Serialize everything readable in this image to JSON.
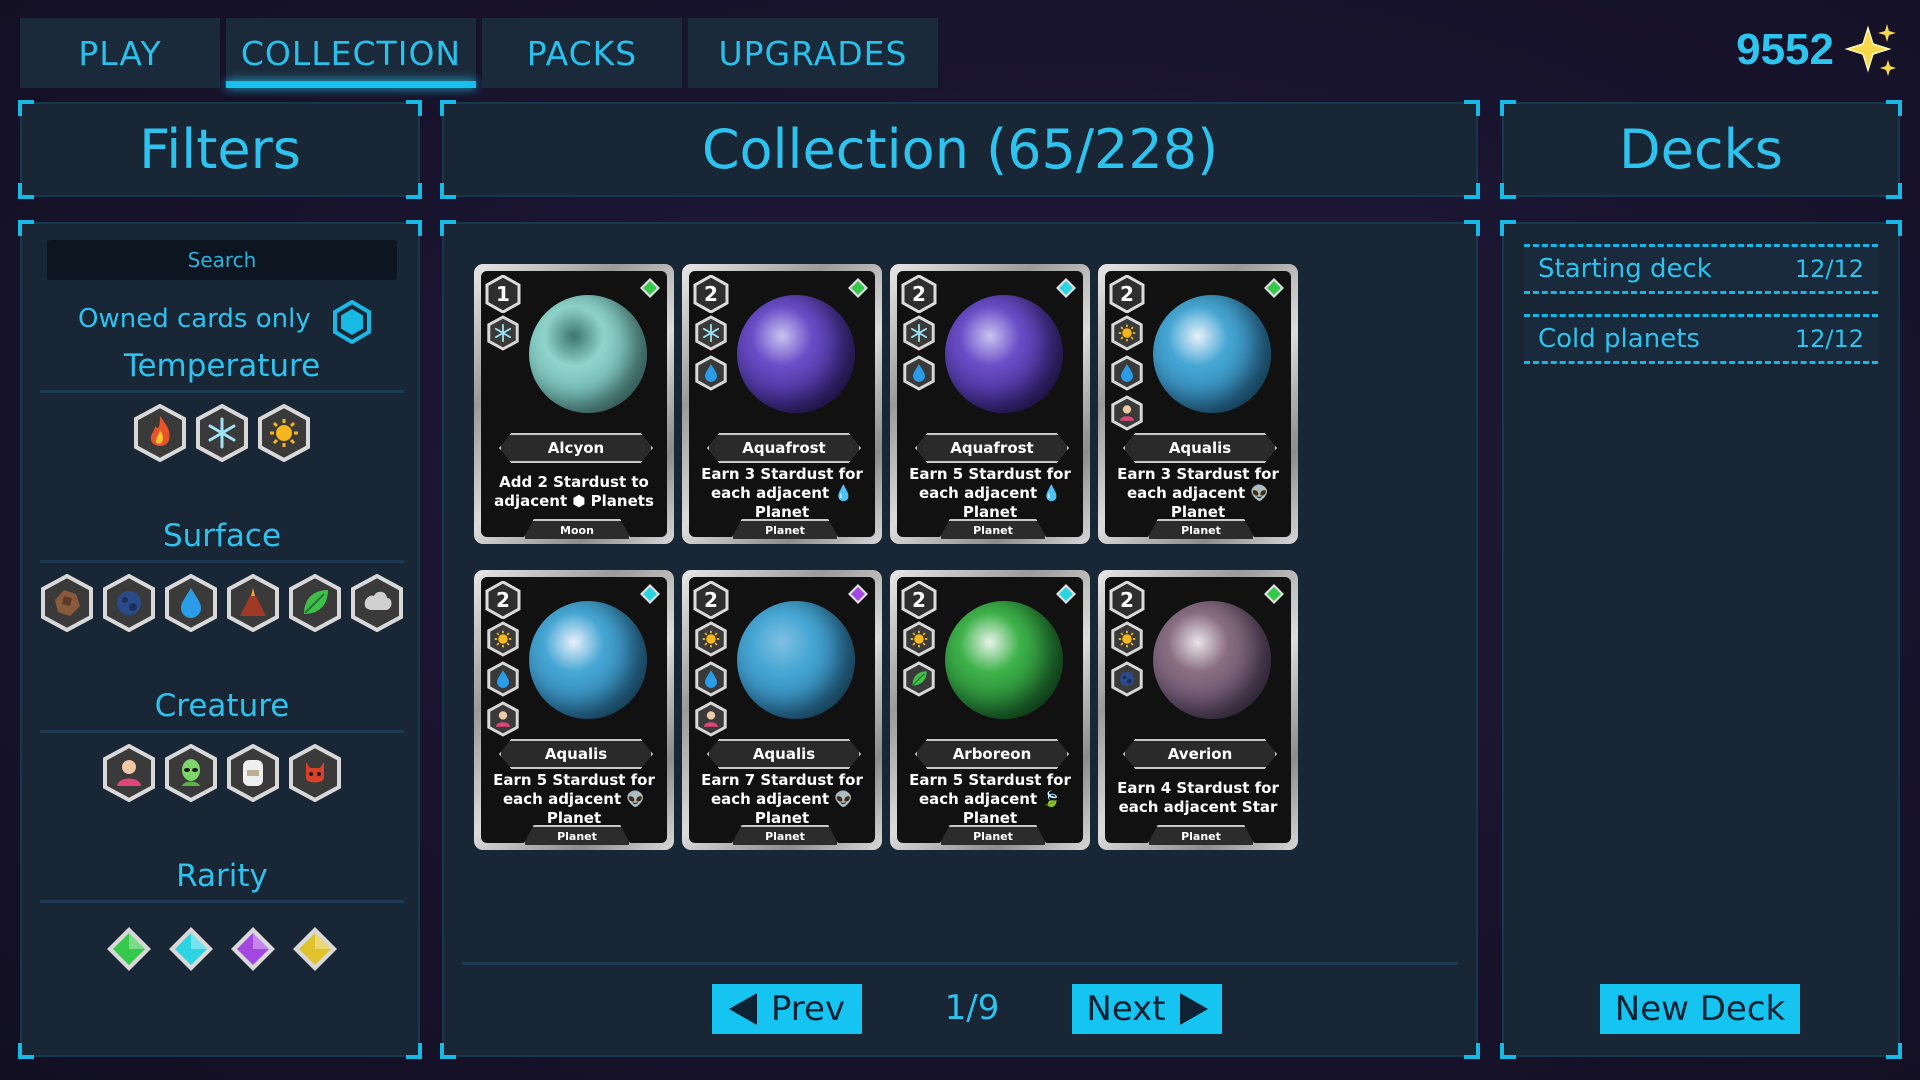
{
  "nav": {
    "tabs": [
      {
        "label": "PLAY"
      },
      {
        "label": "COLLECTION"
      },
      {
        "label": "PACKS"
      },
      {
        "label": "UPGRADES"
      }
    ],
    "active_tab": "COLLECTION",
    "currency": "9552",
    "currency_icon": "stardust-sparkles-icon"
  },
  "filters": {
    "title": "Filters",
    "search_placeholder": "Search",
    "owned_label": "Owned cards only",
    "temperature_title": "Temperature",
    "temperature_icons": [
      "fire-icon",
      "snowflake-icon",
      "sun-icon"
    ],
    "surface_title": "Surface",
    "surface_icons": [
      "rock-icon",
      "crater-icon",
      "water-drop-icon",
      "volcano-icon",
      "leaf-icon",
      "gas-cloud-icon"
    ],
    "creature_title": "Creature",
    "creature_icons": [
      "human-icon",
      "alien-icon",
      "yeti-icon",
      "demon-icon"
    ],
    "rarity_title": "Rarity",
    "rarity_colors": [
      "#34c94a",
      "#2bd4e0",
      "#a347e0",
      "#e0c22a"
    ]
  },
  "collection": {
    "title": "Collection (65/228)",
    "page": "1/9",
    "prev_label": "Prev",
    "next_label": "Next",
    "cards": [
      {
        "cost": "1",
        "name": "Alcyon",
        "desc": [
          "Add 2 Stardust to",
          "adjacent ⬢ Planets"
        ],
        "type": "Moon",
        "rarity": "#34c94a",
        "tags": [
          "snowflake-icon"
        ],
        "colors": [
          "#8fd4cb",
          "#6ab4ae",
          "#3c7470"
        ]
      },
      {
        "cost": "2",
        "name": "Aquafrost",
        "desc": [
          "Earn 3 Stardust for",
          "each adjacent 💧",
          "Planet"
        ],
        "type": "Planet",
        "rarity": "#34c94a",
        "tags": [
          "snowflake-icon",
          "water-drop-icon"
        ],
        "colors": [
          "#6a4ec8",
          "#3d2a8c",
          "#c9c4f0"
        ]
      },
      {
        "cost": "2",
        "name": "Aquafrost",
        "desc": [
          "Earn 5 Stardust for",
          "each adjacent 💧",
          "Planet"
        ],
        "type": "Planet",
        "rarity": "#2bd4e0",
        "tags": [
          "snowflake-icon",
          "water-drop-icon"
        ],
        "colors": [
          "#6a4ec8",
          "#3d2a8c",
          "#c9c4f0"
        ]
      },
      {
        "cost": "2",
        "name": "Aqualis",
        "desc": [
          "Earn 3 Stardust for",
          "each adjacent 👽",
          "Planet"
        ],
        "type": "Planet",
        "rarity": "#34c94a",
        "tags": [
          "sun-icon",
          "water-drop-icon",
          "human-icon"
        ],
        "colors": [
          "#47a7d4",
          "#2d7fb0",
          "#e8f1fb"
        ]
      },
      {
        "cost": "2",
        "name": "Aqualis",
        "desc": [
          "Earn 5 Stardust for",
          "each adjacent 👽",
          "Planet"
        ],
        "type": "Planet",
        "rarity": "#2bd4e0",
        "tags": [
          "sun-icon",
          "water-drop-icon",
          "human-icon"
        ],
        "colors": [
          "#47a7d4",
          "#2d7fb0",
          "#e8f1fb"
        ]
      },
      {
        "cost": "2",
        "name": "Aqualis",
        "desc": [
          "Earn 7 Stardust for",
          "each adjacent 👽",
          "Planet"
        ],
        "type": "Planet",
        "rarity": "#a347e0",
        "tags": [
          "sun-icon",
          "water-drop-icon",
          "human-icon"
        ],
        "colors": [
          "#47a7d4",
          "#2d7fb0",
          "#7fc1e3"
        ]
      },
      {
        "cost": "2",
        "name": "Arboreon",
        "desc": [
          "Earn 5 Stardust for",
          "each adjacent 🍃",
          "Planet"
        ],
        "type": "Planet",
        "rarity": "#2bd4e0",
        "tags": [
          "sun-icon",
          "leaf-icon"
        ],
        "colors": [
          "#3fb34a",
          "#1f7a33",
          "#e8f3ea"
        ]
      },
      {
        "cost": "2",
        "name": "Averion",
        "desc": [
          "Earn 4 Stardust for",
          "each adjacent Star"
        ],
        "type": "Planet",
        "rarity": "#34c94a",
        "tags": [
          "sun-icon",
          "crater-icon"
        ],
        "colors": [
          "#8a6f82",
          "#5f4c6b",
          "#e9e3ea"
        ]
      }
    ]
  },
  "decks": {
    "title": "Decks",
    "items": [
      {
        "name": "Starting deck",
        "count": "12/12"
      },
      {
        "name": "Cold planets",
        "count": "12/12"
      }
    ],
    "new_deck_label": "New Deck"
  }
}
